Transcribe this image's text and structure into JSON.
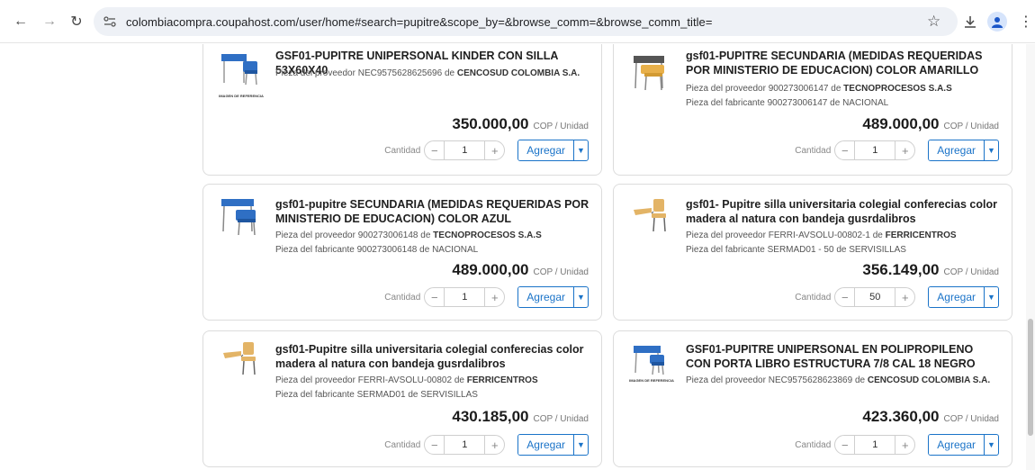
{
  "browser": {
    "url": "colombiacompra.coupahost.com/user/home#search=pupitre&scope_by=&browse_comm=&browse_comm_title="
  },
  "labels": {
    "quantity": "Cantidad",
    "add": "Agregar",
    "unit": "COP / Unidad",
    "supplier_part": "Pieza del proveedor",
    "manufacturer_part": "Pieza del fabricante",
    "of": "de",
    "reference_image": "IMAGEN DE REFERENCIA"
  },
  "products": [
    {
      "title": "GSF01-PUPITRE UNIPERSONAL KINDER CON SILLA 53X60X40",
      "supplier_part": "NEC9575628625696",
      "supplier": "CENCOSUD COLOMBIA S.A.",
      "manufacturer_part": "",
      "manufacturer": "",
      "price": "350.000,00",
      "quantity": "1"
    },
    {
      "title": "gsf01-PUPITRE SECUNDARIA (MEDIDAS REQUERIDAS POR MINISTERIO DE EDUCACION) COLOR AMARILLO",
      "supplier_part": "900273006147",
      "supplier": "TECNOPROCESOS S.A.S",
      "manufacturer_part": "900273006147",
      "manufacturer": "NACIONAL",
      "price": "489.000,00",
      "quantity": "1"
    },
    {
      "title": "gsf01-pupitre SECUNDARIA (MEDIDAS REQUERIDAS POR MINISTERIO DE EDUCACION) COLOR AZUL",
      "supplier_part": "900273006148",
      "supplier": "TECNOPROCESOS S.A.S",
      "manufacturer_part": "900273006148",
      "manufacturer": "NACIONAL",
      "price": "489.000,00",
      "quantity": "1"
    },
    {
      "title": "gsf01- Pupitre silla universitaria colegial conferecias color madera al natura con bandeja gusrdalibros",
      "supplier_part": "FERRI-AVSOLU-00802-1",
      "supplier": "FERRICENTROS",
      "manufacturer_part": "SERMAD01 - 50",
      "manufacturer": "SERVISILLAS",
      "price": "356.149,00",
      "quantity": "50"
    },
    {
      "title": "gsf01-Pupitre silla universitaria colegial conferecias color madera al natura con bandeja gusrdalibros",
      "supplier_part": "FERRI-AVSOLU-00802",
      "supplier": "FERRICENTROS",
      "manufacturer_part": "SERMAD01",
      "manufacturer": "SERVISILLAS",
      "price": "430.185,00",
      "quantity": "1"
    },
    {
      "title": "GSF01-PUPITRE UNIPERSONAL EN POLIPROPILENO CON PORTA LIBRO ESTRUCTURA 7/8 CAL 18 NEGRO",
      "supplier_part": "NEC9575628623869",
      "supplier": "CENCOSUD COLOMBIA S.A.",
      "manufacturer_part": "",
      "manufacturer": "",
      "price": "423.360,00",
      "quantity": "1"
    }
  ],
  "colors": {
    "accent": "#1a73c8",
    "desk_blue": "#2f6fc4",
    "desk_yellow": "#e8b04a",
    "desk_wood": "#e3b466",
    "desk_dark": "#555555"
  }
}
